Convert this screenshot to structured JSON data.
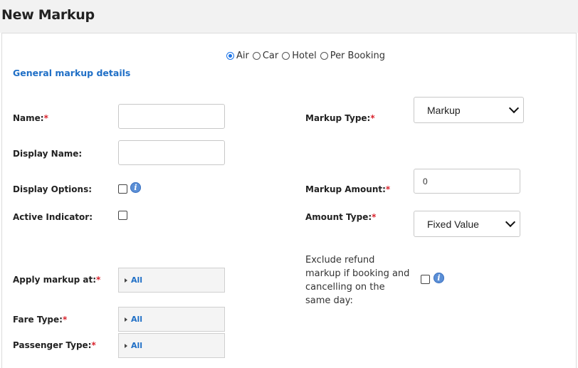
{
  "header": {
    "title": "New Markup"
  },
  "product_types": {
    "options": [
      "Air",
      "Car",
      "Hotel",
      "Per Booking"
    ],
    "selected": "Air"
  },
  "section": {
    "title": "General markup details"
  },
  "fields": {
    "name": {
      "label": "Name:",
      "required_mark": "*",
      "value": ""
    },
    "display_name": {
      "label": "Display Name:",
      "value": ""
    },
    "display_options": {
      "label": "Display Options:",
      "checked": false
    },
    "active_indicator": {
      "label": "Active Indicator:",
      "checked": false
    },
    "markup_type": {
      "label": "Markup Type:",
      "required_mark": "*",
      "value": "Markup"
    },
    "markup_amount": {
      "label": "Markup Amount:",
      "required_mark": "*",
      "value": "0"
    },
    "amount_type": {
      "label": "Amount Type:",
      "required_mark": "*",
      "value": "Fixed Value"
    },
    "exclude_refund": {
      "label": "Exclude refund markup if booking and cancelling on the same day:",
      "checked": false
    },
    "apply_markup_at": {
      "label": "Apply markup at:",
      "required_mark": "*",
      "value": "All"
    },
    "fare_type": {
      "label": "Fare Type:",
      "required_mark": "*",
      "value": "All"
    },
    "passenger_type": {
      "label": "Passenger Type:",
      "required_mark": "*",
      "value": "All"
    }
  },
  "icons": {
    "info": "info-icon",
    "dropdown": "chevron-down-icon",
    "expand": "caret-right-icon"
  },
  "colors": {
    "accent": "#1f6fc6",
    "required": "#d9232d",
    "header_bg": "#f2f2f2"
  }
}
